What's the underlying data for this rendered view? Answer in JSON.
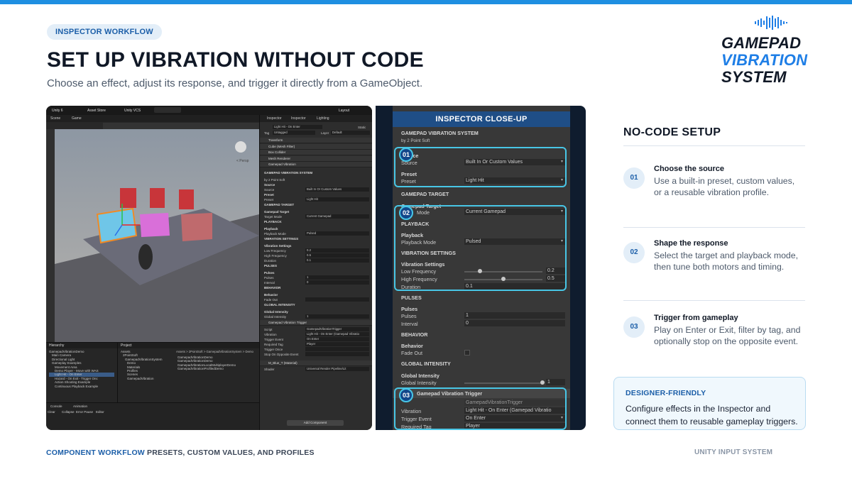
{
  "header": {
    "pill": "INSPECTOR WORKFLOW",
    "title": "SET UP VIBRATION WITHOUT CODE",
    "subtitle": "Choose an effect, adjust its response, and trigger it directly from a GameObject."
  },
  "logo": {
    "line1": "GAMEPAD",
    "line2": "VIBRATION",
    "line3": "SYSTEM",
    "icon": "soundwave-icon"
  },
  "colors": {
    "accent": "#1e8fe1",
    "brand_blue": "#1e7ee6",
    "highlight": "#48c6e6",
    "dark_navy": "#101826"
  },
  "editor": {
    "toolbar": {
      "version": "Unity 6",
      "asset_store": "Asset Store",
      "vcs": "Unity VCS",
      "layout": "Layout"
    },
    "scene_tabs": [
      "Scene",
      "Game"
    ],
    "persp_label": "< Persp",
    "inspector_tabs": [
      "Inspector",
      "Inspector",
      "Lighting"
    ],
    "object_name": "Light Hit - On Enter",
    "static_label": "Static",
    "tag_label": "Tag",
    "tag_value": "Untagged",
    "layer_label": "Layer",
    "layer_value": "Default",
    "components": [
      "Transform",
      "Cube (Mesh Filter)",
      "Box Collider",
      "Mesh Renderer",
      "Gamepad Vibration"
    ],
    "rows": [
      {
        "t": "GAMEPAD VIBRATION SYSTEM",
        "h": true
      },
      {
        "t": "by 2 Point Soft"
      },
      {
        "t": "Source",
        "h": true
      },
      {
        "t": "Source",
        "v": "Built In Or Custom Values"
      },
      {
        "t": "Preset",
        "h": true
      },
      {
        "t": "Preset",
        "v": "Light Hit"
      },
      {
        "t": "GAMEPAD TARGET",
        "h": true
      },
      {
        "t": "Gamepad Target",
        "h": true
      },
      {
        "t": "Target Mode",
        "v": "Current Gamepad"
      },
      {
        "t": "PLAYBACK",
        "h": true
      },
      {
        "t": "Playback",
        "h": true
      },
      {
        "t": "Playback Mode",
        "v": "Pulsed"
      },
      {
        "t": "VIBRATION SETTINGS",
        "h": true
      },
      {
        "t": "Vibration Settings",
        "h": true
      },
      {
        "t": "Low Frequency",
        "v": "0.2"
      },
      {
        "t": "High Frequency",
        "v": "0.5"
      },
      {
        "t": "Duration",
        "v": "0.1"
      },
      {
        "t": "PULSES",
        "h": true
      },
      {
        "t": "Pulses",
        "h": true
      },
      {
        "t": "Pulses",
        "v": "1"
      },
      {
        "t": "Interval",
        "v": "0"
      },
      {
        "t": "BEHAVIOR",
        "h": true
      },
      {
        "t": "Behavior",
        "h": true
      },
      {
        "t": "Fade Out",
        "v": ""
      },
      {
        "t": "GLOBAL INTENSITY",
        "h": true
      },
      {
        "t": "Global Intensity",
        "h": true
      },
      {
        "t": "Global Intensity",
        "v": "1"
      }
    ],
    "trigger_component": "Gamepad Vibration Trigger",
    "trigger_rows": [
      {
        "t": "Script",
        "v": "GamepadVibrationTrigger"
      },
      {
        "t": "Vibration",
        "v": "Light Hit - On Enter (Gamepad Vibratio"
      },
      {
        "t": "Trigger Event",
        "v": "On Enter"
      },
      {
        "t": "Required Tag",
        "v": "Player"
      },
      {
        "t": "Trigger Once",
        "v": ""
      },
      {
        "t": "Stop On Opposite Event",
        "v": ""
      }
    ],
    "material": "M_Blue_T (Material)",
    "shader_label": "Shader",
    "shader_value": "Universal Render Pipeline/Lit",
    "add_component": "Add Component",
    "hierarchy_tab": "Hierarchy",
    "hierarchy": [
      "GamepadVibrationDemo",
      "Main Camera",
      "Directional Light",
      "Gameplay Examples",
      "Movement Area",
      "Demo Player - Move with WAS",
      "Light Hit - On Enter",
      "Hazard - On Exit - Trigger Onc",
      "Action Shooting Example",
      "Continuous Playback Example"
    ],
    "hierarchy_selected": 6,
    "project_tab": "Project",
    "project_tree": [
      "Assets",
      "2PointSoft",
      "GamepadVibrationSystem",
      "Demo",
      "Materials",
      "Profiles",
      "Scenes",
      "GamepadVibration"
    ],
    "project_path": "Assets > 2PointSoft > GamepadVibrationSystem > Demo",
    "project_files": [
      "GamepadVibrationDemo",
      "GamepadVibrationDemo",
      "GamepadVibrationLocalMultiplayerDemo",
      "GamepadVibrationProfiledDemo"
    ],
    "console_tab": "Console",
    "animation_tab": "Animation",
    "console_buttons": [
      "Clear",
      "Collapse",
      "Error Pause",
      "Editor"
    ]
  },
  "closeup": {
    "title": "INSPECTOR CLOSE-UP",
    "system_name": "GAMEPAD VIBRATION SYSTEM",
    "author": "by 2 Point Soft",
    "source_header": "Source",
    "source_label": "Source",
    "source_value": "Built In Or Custom Values",
    "preset_header": "Preset",
    "preset_label": "Preset",
    "preset_value": "Light Hit",
    "target_section": "GAMEPAD TARGET",
    "target_header": "Gamepad Target",
    "target_label": "Mode",
    "target_value": "Current Gamepad",
    "playback_section": "PLAYBACK",
    "playback_header": "Playback",
    "playback_label": "Playback Mode",
    "playback_value": "Pulsed",
    "vibration_section": "VIBRATION SETTINGS",
    "vibration_header": "Vibration Settings",
    "low_label": "Low Frequency",
    "low_value": "0.2",
    "high_label": "High Frequency",
    "high_value": "0.5",
    "duration_label": "Duration",
    "duration_value": "0.1",
    "pulses_section": "PULSES",
    "pulses_header": "Pulses",
    "pulses_label": "Pulses",
    "pulses_value": "1",
    "interval_label": "Interval",
    "interval_value": "0",
    "behavior_section": "BEHAVIOR",
    "behavior_header": "Behavior",
    "fade_label": "Fade Out",
    "global_section": "GLOBAL INTENSITY",
    "global_header": "Global Intensity",
    "global_label": "Global Intensity",
    "global_value": "1",
    "trigger_title": "Gamepad Vibration Trigger",
    "script_value": "GamepadVibrationTrigger",
    "vibration_label": "Vibration",
    "vibration_value": "Light Hit - On Enter (Gamepad Vibratio",
    "trigger_event_label": "Trigger Event",
    "trigger_event_value": "On Enter",
    "required_tag_label": "Required Tag",
    "required_tag_value": "Player",
    "badges": [
      "01",
      "02",
      "03"
    ],
    "slider_levels": {
      "low": 0.2,
      "high": 0.5,
      "global": 1.0
    }
  },
  "steps_title": "NO-CODE SETUP",
  "steps": [
    {
      "num": "01",
      "title": "Choose the source",
      "desc": "Use a built-in preset, custom values, or a reusable vibration profile."
    },
    {
      "num": "02",
      "title": "Shape the response",
      "desc": "Select the target and playback mode, then tune both motors and timing."
    },
    {
      "num": "03",
      "title": "Trigger from gameplay",
      "desc": "Play on Enter or Exit, filter by tag, and optionally stop on the opposite event."
    }
  ],
  "callout": {
    "title": "DESIGNER-FRIENDLY",
    "desc": "Configure effects in the Inspector and connect them to reusable gameplay triggers."
  },
  "footer": {
    "left_accent": "COMPONENT WORKFLOW",
    "left_text": "PRESETS, CUSTOM VALUES, AND PROFILES",
    "right": "UNITY INPUT SYSTEM"
  }
}
